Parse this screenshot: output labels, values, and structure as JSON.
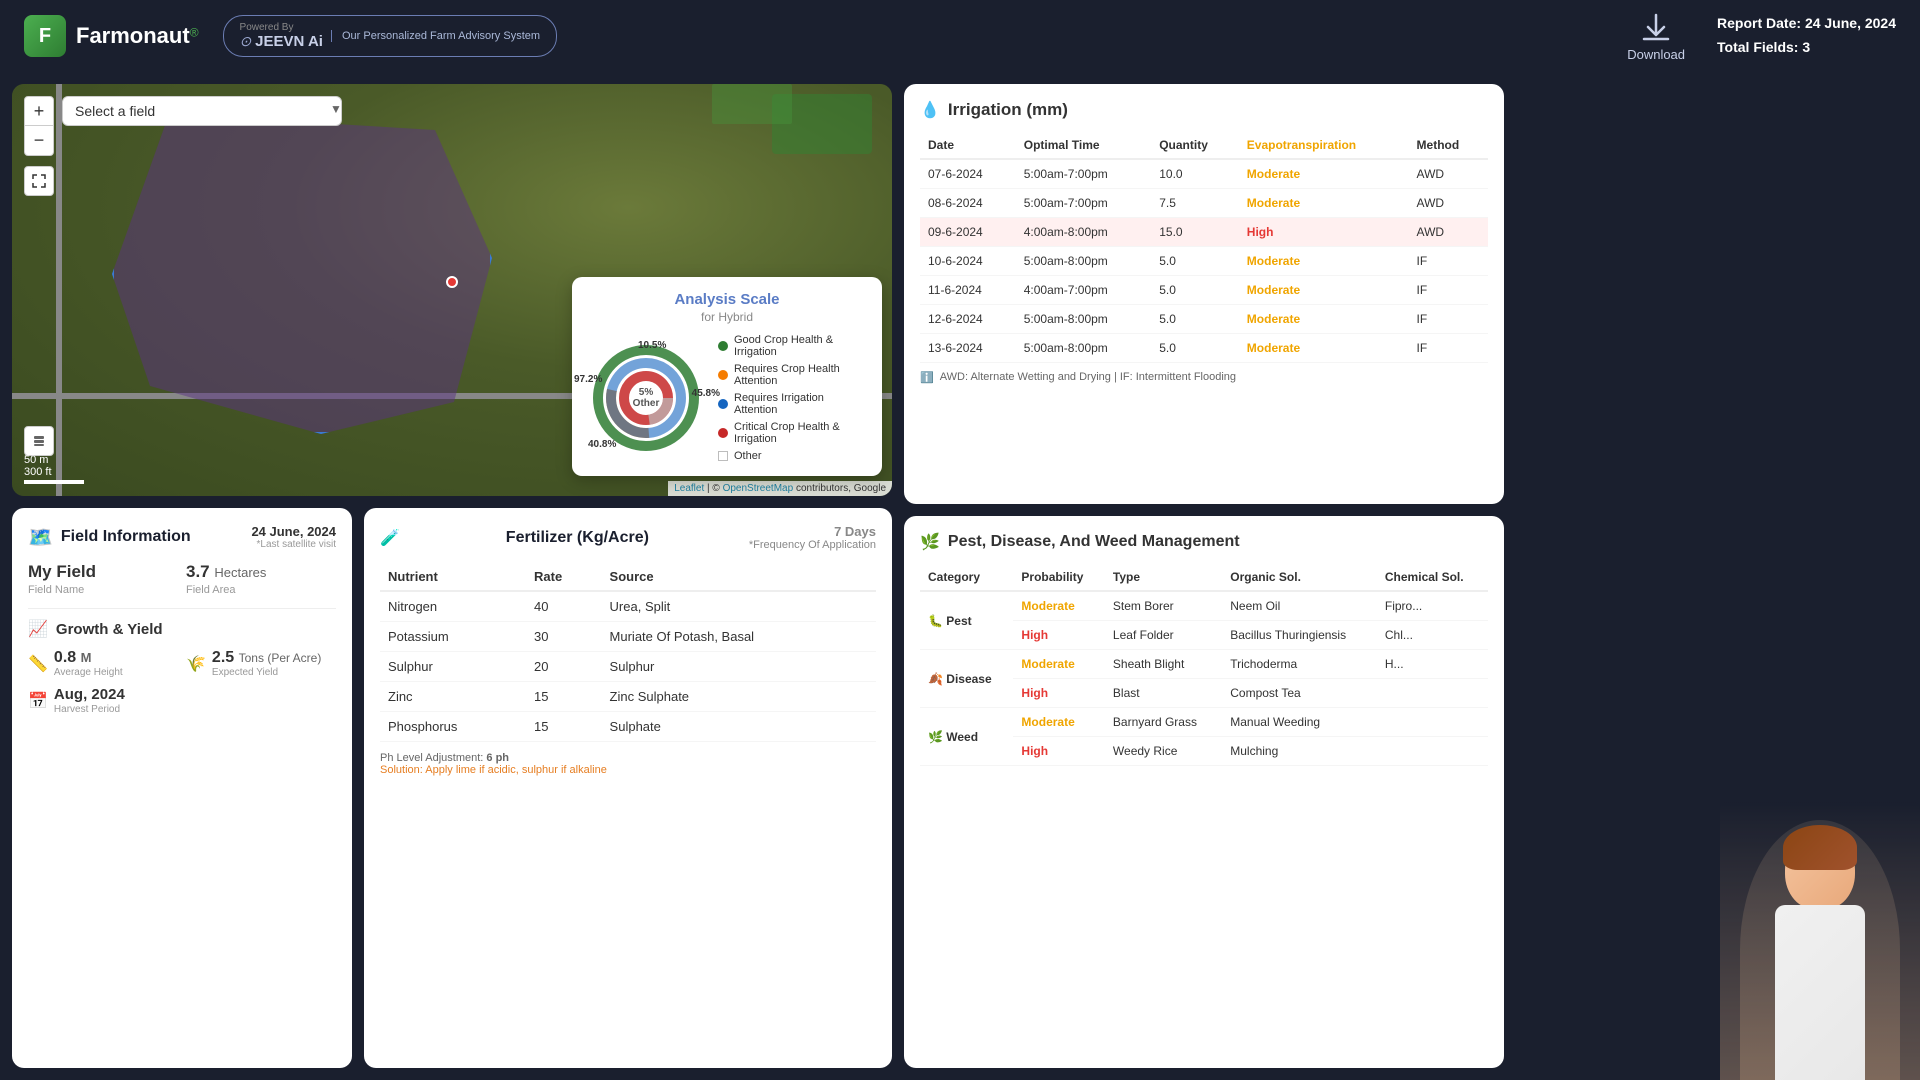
{
  "header": {
    "logo_text": "Farmonaut",
    "logo_reg": "®",
    "jeevn_title": "JEEVN Ai",
    "powered_by": "Powered By",
    "advisory": "Our Personalized Farm Advisory System",
    "download_label": "Download",
    "report_date_label": "Report Date:",
    "report_date_value": "24 June, 2024",
    "total_fields_label": "Total Fields:",
    "total_fields_value": "3"
  },
  "map": {
    "select_placeholder": "Select a field",
    "zoom_in": "+",
    "zoom_out": "−",
    "scale_m": "50 m",
    "scale_ft": "300 ft",
    "attribution": "Leaflet | © OpenStreetMap contributors, Google"
  },
  "analysis_scale": {
    "title": "Analysis Scale",
    "subtitle": "for Hybrid",
    "items": [
      {
        "color": "#2e7d32",
        "label": "Good Crop Health & Irrigation",
        "pct": "97.2%",
        "value": 97.2
      },
      {
        "color": "#f57c00",
        "label": "Requires Crop Health Attention",
        "pct": "10.5%",
        "value": 10.5
      },
      {
        "color": "#1565c0",
        "label": "Requires Irrigation Attention",
        "pct": "45.8%",
        "value": 45.8
      },
      {
        "color": "#c62828",
        "label": "Critical Crop Health & Irrigation",
        "pct": "40.8%",
        "value": 40.8
      },
      {
        "color": "#bdbdbd",
        "label": "Other",
        "pct": "5%",
        "value": 5
      }
    ],
    "center_label": "5%\nOther"
  },
  "field_info": {
    "section_title": "Field Information",
    "date": "24 June, 2024",
    "date_sub": "*Last satellite visit",
    "field_name_label": "Field Name",
    "field_name_value": "My Field",
    "field_area_label": "Field Area",
    "field_area_value": "3.7",
    "field_area_unit": "Hectares",
    "growth_title": "Growth & Yield",
    "avg_height_value": "0.8",
    "avg_height_unit": "M",
    "avg_height_label": "Average Height",
    "expected_yield_value": "2.5",
    "expected_yield_unit": "Tons",
    "expected_yield_per": "(Per Acre)",
    "expected_yield_label": "Expected Yield",
    "harvest_value": "Aug, 2024",
    "harvest_label": "Harvest Period"
  },
  "fertilizer": {
    "section_title": "Fertilizer (Kg/Acre)",
    "freq_days": "7 Days",
    "freq_label": "*Frequency Of Application",
    "col_nutrient": "Nutrient",
    "col_rate": "Rate",
    "col_source": "Source",
    "rows": [
      {
        "nutrient": "Nitrogen",
        "rate": "40",
        "source": "Urea, Split"
      },
      {
        "nutrient": "Potassium",
        "rate": "30",
        "source": "Muriate Of Potash, Basal"
      },
      {
        "nutrient": "Sulphur",
        "rate": "20",
        "source": "Sulphur"
      },
      {
        "nutrient": "Zinc",
        "rate": "15",
        "source": "Zinc Sulphate"
      },
      {
        "nutrient": "Phosphorus",
        "rate": "15",
        "source": "Sulphate"
      }
    ],
    "ph_label": "Ph Level Adjustment:",
    "ph_value": "6 ph",
    "solution_label": "Solution:",
    "solution_value": "Apply lime if acidic, sulphur if alkaline"
  },
  "irrigation": {
    "section_title": "Irrigation (mm)",
    "col_date": "Date",
    "col_optimal_time": "Optimal Time",
    "col_quantity": "Quantity",
    "col_evapotranspiration": "Evapotranspiration",
    "col_method": "Method",
    "rows": [
      {
        "date": "07-6-2024",
        "optimal_time": "5:00am-7:00pm",
        "quantity": "10.0",
        "evapotranspiration": "Moderate",
        "method": "AWD",
        "highlight": false
      },
      {
        "date": "08-6-2024",
        "optimal_time": "5:00am-7:00pm",
        "quantity": "7.5",
        "evapotranspiration": "Moderate",
        "method": "AWD",
        "highlight": false
      },
      {
        "date": "09-6-2024",
        "optimal_time": "4:00am-8:00pm",
        "quantity": "15.0",
        "evapotranspiration": "High",
        "method": "AWD",
        "highlight": true
      },
      {
        "date": "10-6-2024",
        "optimal_time": "5:00am-8:00pm",
        "quantity": "5.0",
        "evapotranspiration": "Moderate",
        "method": "IF",
        "highlight": false
      },
      {
        "date": "11-6-2024",
        "optimal_time": "4:00am-7:00pm",
        "quantity": "5.0",
        "evapotranspiration": "Moderate",
        "method": "IF",
        "highlight": false
      },
      {
        "date": "12-6-2024",
        "optimal_time": "5:00am-8:00pm",
        "quantity": "5.0",
        "evapotranspiration": "Moderate",
        "method": "IF",
        "highlight": false
      },
      {
        "date": "13-6-2024",
        "optimal_time": "5:00am-8:00pm",
        "quantity": "5.0",
        "evapotranspiration": "Moderate",
        "method": "IF",
        "highlight": false
      }
    ],
    "note": "AWD: Alternate Wetting and Drying | IF: Intermittent Flooding"
  },
  "pest": {
    "section_title": "Pest, Disease, And Weed Management",
    "col_category": "Category",
    "col_probability": "Probability",
    "col_type": "Type",
    "col_organic": "Organic Sol.",
    "col_chemical": "Chemical Sol.",
    "rows": [
      {
        "category": "Pest",
        "icon": "🐛",
        "probability": "Moderate",
        "type": "Stem Borer",
        "organic": "Neem Oil",
        "chemical": "Fipro..."
      },
      {
        "category": "Pest",
        "icon": "🐛",
        "probability": "High",
        "type": "Leaf Folder",
        "organic": "Bacillus Thuringiensis",
        "chemical": "Chl..."
      },
      {
        "category": "Disease",
        "icon": "🍂",
        "probability": "Moderate",
        "type": "Sheath Blight",
        "organic": "Trichoderma",
        "chemical": "H..."
      },
      {
        "category": "Disease",
        "icon": "🍂",
        "probability": "High",
        "type": "Blast",
        "organic": "Compost Tea",
        "chemical": ""
      },
      {
        "category": "Weed",
        "icon": "🌿",
        "probability": "Moderate",
        "type": "Barnyard Grass",
        "organic": "Manual Weeding",
        "chemical": ""
      },
      {
        "category": "Weed",
        "icon": "🌿",
        "probability": "High",
        "type": "Weedy Rice",
        "organic": "Mulching",
        "chemical": ""
      }
    ]
  }
}
